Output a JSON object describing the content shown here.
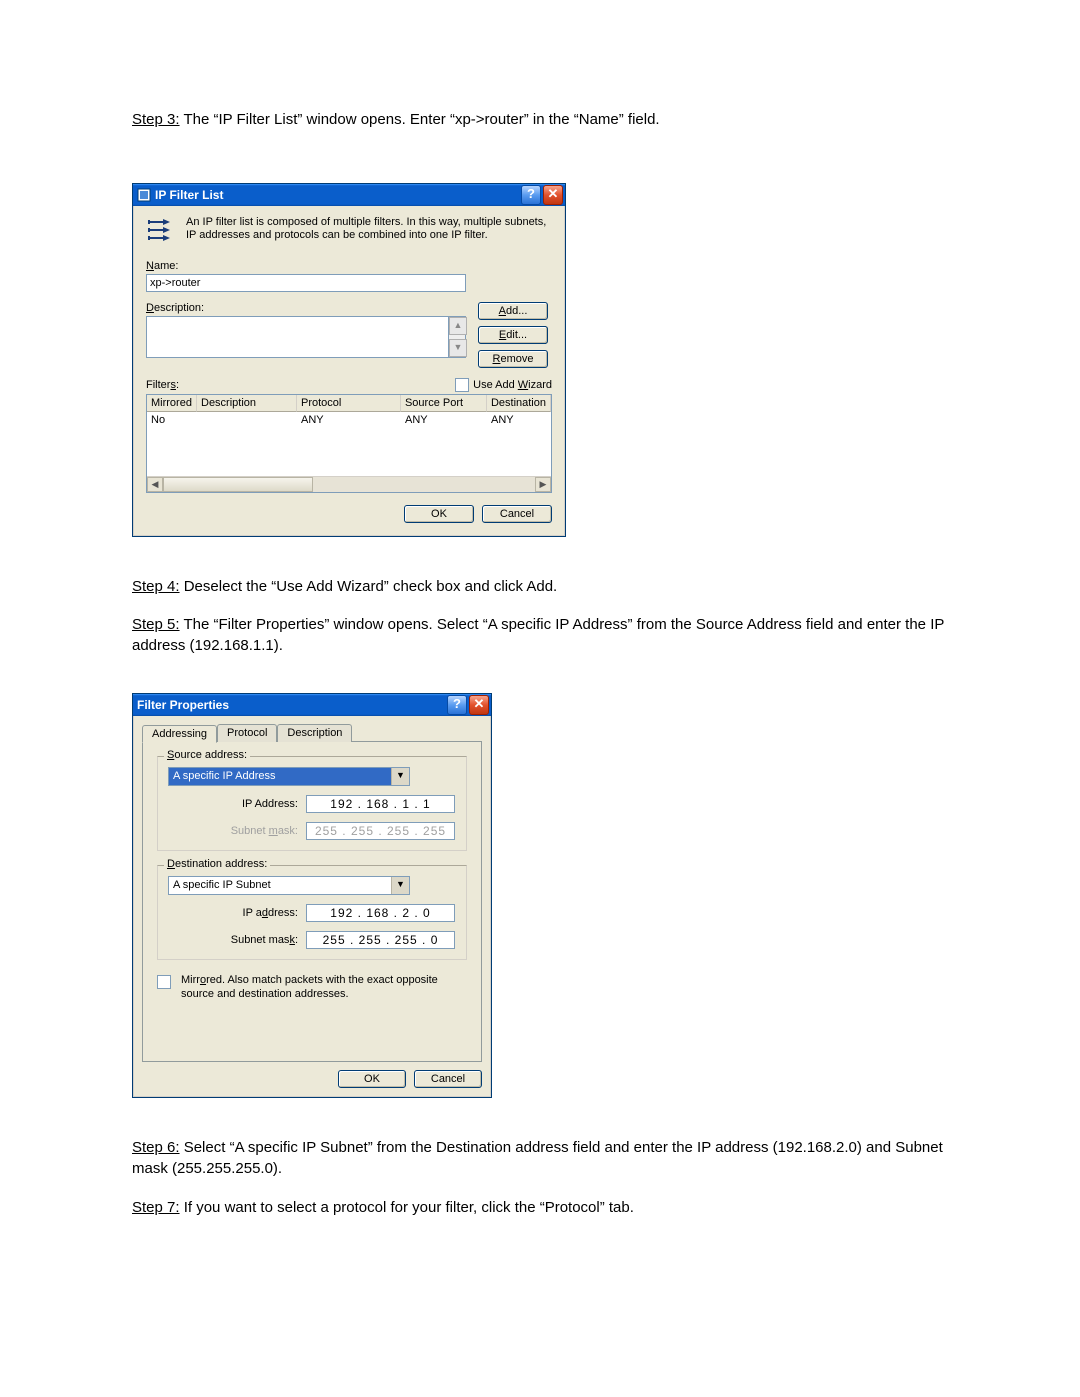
{
  "step3": {
    "label": "Step 3:",
    "text": " The “IP Filter List” window opens. Enter “xp->router” in the “Name” field."
  },
  "step4": {
    "label": "Step 4:",
    "text": " Deselect the “Use Add Wizard” check box and click Add."
  },
  "step5": {
    "label": "Step 5:",
    "text": " The “Filter Properties” window opens. Select “A specific IP Address” from the Source Address field and enter the IP address (192.168.1.1)."
  },
  "step6": {
    "label": "Step 6:",
    "text": " Select “A specific IP Subnet” from the Destination address field and enter the IP address (192.168.2.0) and Subnet mask (255.255.255.0)."
  },
  "step7": {
    "label": "Step 7:",
    "text": " If you want to select a protocol for your filter, click the “Protocol” tab."
  },
  "ipFilterList": {
    "title": "IP Filter List",
    "intro": "An IP filter list is composed of multiple filters. In this way, multiple subnets, IP addresses and protocols can be combined into one IP filter.",
    "nameLabel": "Name:",
    "nameUnderline": "N",
    "nameValue": "xp->router",
    "descLabel": "Description:",
    "descUnderline": "D",
    "descValue": "",
    "addBtn": "Add...",
    "addUnderline": "A",
    "editBtn": "Edit...",
    "editUnderline": "E",
    "removeBtn": "Remove",
    "removeUnderline": "R",
    "filtersLabel": "Filters:",
    "filtersUnderline": "s",
    "useWizard": "Use Add Wizard",
    "useWizardUnderline": "W",
    "headers": [
      "Mirrored",
      "Description",
      "Protocol",
      "Source Port",
      "Destination"
    ],
    "row": [
      "No",
      "",
      "ANY",
      "ANY",
      "ANY"
    ],
    "ok": "OK",
    "cancel": "Cancel",
    "help": "?"
  },
  "filterProps": {
    "title": "Filter Properties",
    "tabs": [
      "Addressing",
      "Protocol",
      "Description"
    ],
    "source": {
      "legend": "Source address:",
      "legendUnderline": "S",
      "dropdown": "A specific IP Address",
      "ipLabel": "IP Address:",
      "ipValue": "192  .  168   .     1    .     1",
      "maskLabel": "Subnet mask:",
      "maskUnderline": "m",
      "maskValue": "255  .  255  .  255  .  255"
    },
    "dest": {
      "legend": "Destination address:",
      "legendUnderline": "D",
      "dropdown": "A specific IP Subnet",
      "ipLabel": "IP address:",
      "ipUnderline": "d",
      "ipValue": "192  .  168   .     2    .     0",
      "maskLabel": "Subnet mask:",
      "maskUnderline": "k",
      "maskValue": "255  .  255  .  255   .     0"
    },
    "mirrored": "Mirrored. Also match packets with the exact opposite source and destination addresses.",
    "mirroredUnderline": "o",
    "ok": "OK",
    "cancel": "Cancel",
    "help": "?"
  }
}
